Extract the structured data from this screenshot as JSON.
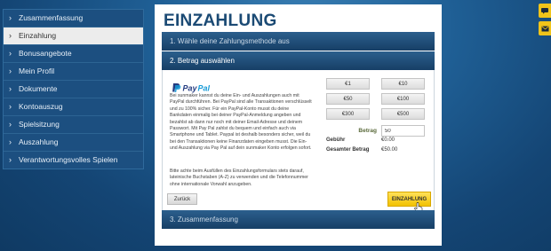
{
  "sidebar": {
    "items": [
      {
        "label": "Zusammenfassung",
        "active": false
      },
      {
        "label": "Einzahlung",
        "active": true
      },
      {
        "label": "Bonusangebote",
        "active": false
      },
      {
        "label": "Mein Profil",
        "active": false
      },
      {
        "label": "Dokumente",
        "active": false
      },
      {
        "label": "Kontoauszug",
        "active": false
      },
      {
        "label": "Spielsitzung",
        "active": false
      },
      {
        "label": "Auszahlung",
        "active": false
      },
      {
        "label": "Verantwortungsvolles Spielen",
        "active": false
      }
    ]
  },
  "main": {
    "title": "EINZAHLUNG",
    "step1": "1. Wähle deine Zahlungsmethode aus",
    "step2": "2. Betrag auswählen",
    "step3": "3. Zusammenfassung",
    "paypal": {
      "logo_p": "Pay",
      "logo_pal": "Pal",
      "description": "Bei sunmaker kannst du deine Ein- und Auszahlungen auch mit PayPal durchführen. Bei PayPal sind alle Transaktionen verschlüsselt und zu 100% sicher. Für ein PayPal-Konto musst du deine Bankdaten einmalig bei deiner PayPal-Anmeldung angeben und bezahlst ab dann nur noch mit deiner Email-Adresse und deinem Passwort. Mit Pay Pal zahlst du bequem und einfach auch via Smartphone und Tablet. Paypal ist deshalb besonders sicher, weil du bei den Transaktionen keine Finanzdaten eingeben musst. Die Ein- und Auszahlung via Pay Pal auf dein sunmaker Konto erfolgen sofort.",
      "note": "Bitte achte beim Ausfüllen des Einzahlungsformulars stets darauf, lateinische Buchstaben (A-Z) zu verwenden und die Telefonnummer ohne internationale Vorwahl anzugeben."
    },
    "amounts": [
      "€1",
      "€10",
      "€50",
      "€100",
      "€300",
      "€500"
    ],
    "betrag_label": "Betrag",
    "betrag_value": "50",
    "gebuehr_label": "Gebühr",
    "gebuehr_value": "€0.00",
    "gesamt_label": "Gesamter Betrag",
    "gesamt_value": "€50.00",
    "back_button": "Zurück",
    "submit_button": "EINZAHLUNG"
  },
  "colors": {
    "accent_yellow": "#f2c200",
    "header_blue": "#1b4a74",
    "step_bar": "#173f66"
  },
  "icons": {
    "sidebar": "chevron-right-icon",
    "right_tabs": [
      "chat-icon",
      "mail-icon"
    ]
  }
}
